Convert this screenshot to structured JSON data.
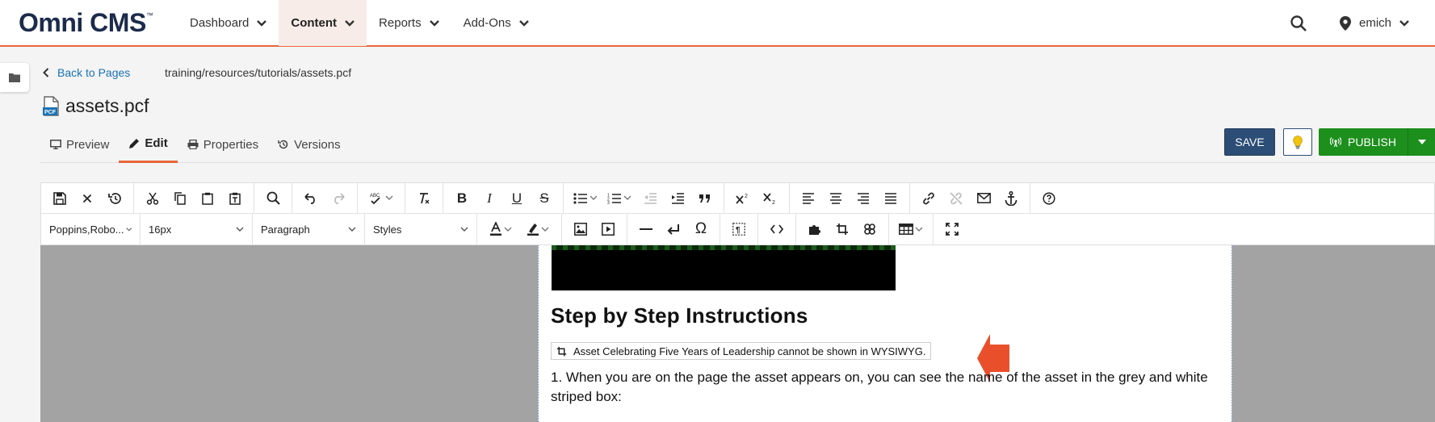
{
  "app": {
    "logo": "Omni CMS",
    "logo_mark": "™"
  },
  "nav": {
    "items": [
      {
        "label": "Dashboard"
      },
      {
        "label": "Content"
      },
      {
        "label": "Reports"
      },
      {
        "label": "Add-Ons"
      }
    ],
    "active": "Content"
  },
  "user": {
    "name": "emich"
  },
  "breadcrumb": {
    "back_label": "Back to Pages",
    "path": "training/resources/tutorials/assets.pcf"
  },
  "file": {
    "name": "assets.pcf",
    "badge": "PCF"
  },
  "tabs": [
    {
      "label": "Preview"
    },
    {
      "label": "Edit"
    },
    {
      "label": "Properties"
    },
    {
      "label": "Versions"
    }
  ],
  "actions": {
    "save_label": "SAVE",
    "publish_label": "PUBLISH"
  },
  "toolbar": {
    "font_family": "Poppins,Robo...",
    "font_size": "16px",
    "block_format": "Paragraph",
    "styles": "Styles"
  },
  "content": {
    "heading": "Step by Step Instructions",
    "asset_notice": "Asset Celebrating Five Years of Leadership cannot be shown in WYSIWYG.",
    "paragraph": "1. When you are on the page the asset appears on, you can see the name of the asset in the grey and white striped box:"
  },
  "colors": {
    "accent": "#e8663a",
    "save": "#2c4d75",
    "publish": "#1d8f1d",
    "link": "#1a73b5"
  }
}
